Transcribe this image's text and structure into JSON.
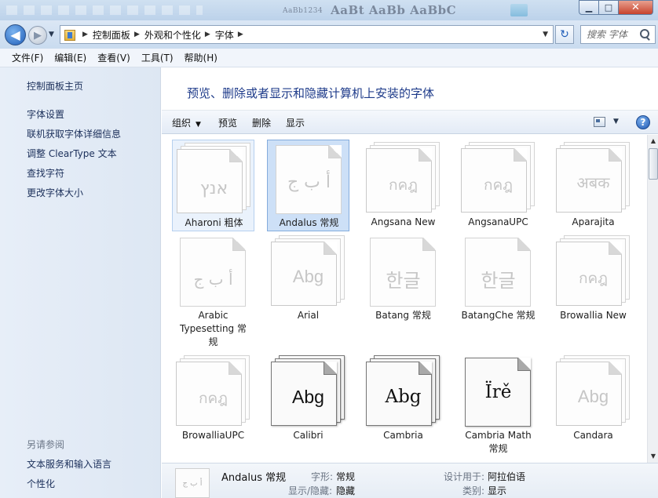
{
  "window": {
    "title_ghost_small": "AaBb1234",
    "title_ghost": "AaBt AaBb AaBbC",
    "controls": {
      "minimize": "▁",
      "maximize": "□",
      "close": "✕"
    }
  },
  "address": {
    "back_glyph": "◀",
    "forward_glyph": "▶",
    "crumbs": [
      "控制面板",
      "外观和个性化",
      "字体"
    ],
    "separator": "▶",
    "refresh_glyph": "↻",
    "search_placeholder": "搜索 字体"
  },
  "menu": [
    "文件(F)",
    "编辑(E)",
    "查看(V)",
    "工具(T)",
    "帮助(H)"
  ],
  "sidebar": {
    "home": "控制面板主页",
    "links": [
      "字体设置",
      "联机获取字体详细信息",
      "调整 ClearType 文本",
      "查找字符",
      "更改字体大小"
    ],
    "see_also_label": "另请参阅",
    "see_also": [
      "文本服务和输入语言",
      "个性化"
    ]
  },
  "page": {
    "title": "预览、删除或者显示和隐藏计算机上安装的字体"
  },
  "toolbar": {
    "organize": "组织",
    "preview": "预览",
    "delete": "删除",
    "show": "显示",
    "help": "?"
  },
  "fonts": [
    {
      "name": "Aharoni 粗体",
      "sample": "אנץ"
    },
    {
      "name": "Andalus 常规",
      "sample": "أ ب ج"
    },
    {
      "name": "Angsana New",
      "sample": "กคฎ"
    },
    {
      "name": "AngsanaUPC",
      "sample": "กคฎ"
    },
    {
      "name": "Aparajita",
      "sample": "अबक"
    },
    {
      "name": "Arabic Typesetting 常规",
      "sample": "أ ب ج"
    },
    {
      "name": "Arial",
      "sample": "Abg"
    },
    {
      "name": "Batang 常规",
      "sample": "한글"
    },
    {
      "name": "BatangChe 常规",
      "sample": "한글"
    },
    {
      "name": "Browallia New",
      "sample": "กคฎ"
    },
    {
      "name": "BrowalliaUPC",
      "sample": "กคฎ"
    },
    {
      "name": "Calibri",
      "sample": "Abg"
    },
    {
      "name": "Cambria",
      "sample": "Abg"
    },
    {
      "name": "Cambria Math 常规",
      "sample": "Ïrě"
    },
    {
      "name": "Candara",
      "sample": "Abg"
    }
  ],
  "details": {
    "thumb_sample": "أ ب ج",
    "name": "Andalus 常规",
    "style_label": "字形:",
    "style_value": "常规",
    "visibility_label": "显示/隐藏:",
    "visibility_value": "隐藏",
    "designed_for_label": "设计用于:",
    "designed_for_value": "阿拉伯语",
    "category_label": "类别:",
    "category_value": "显示"
  }
}
